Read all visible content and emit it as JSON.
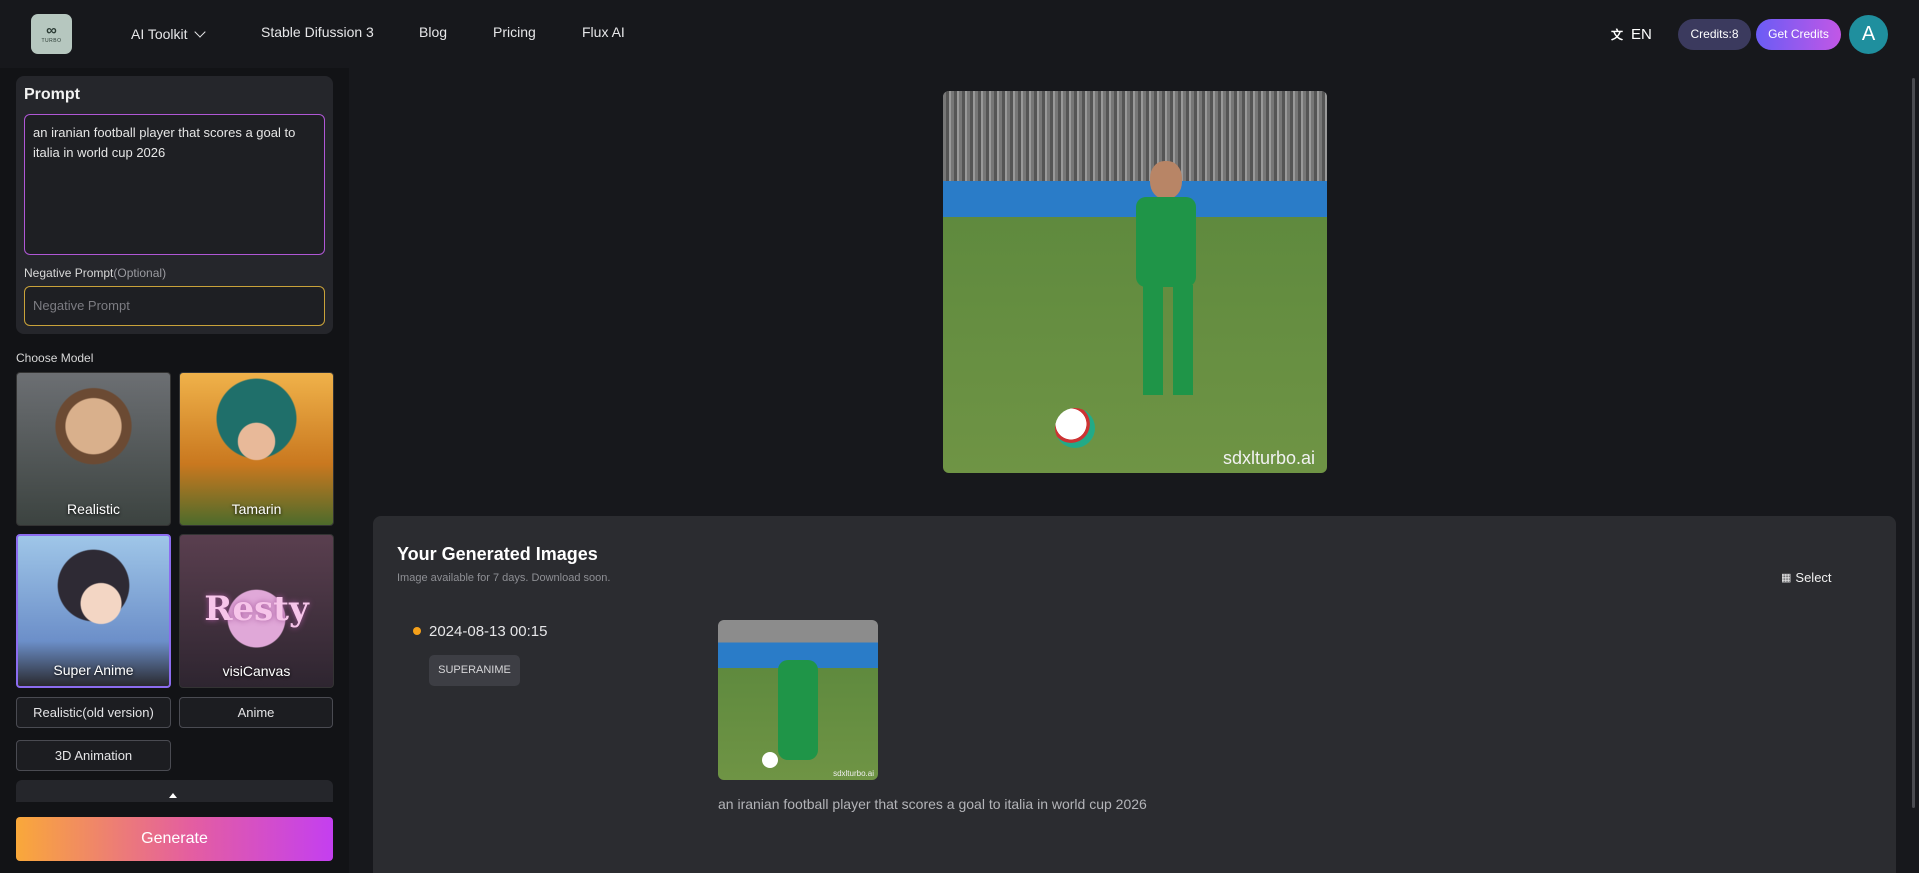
{
  "header": {
    "logo_text": "TURBO",
    "nav": [
      "AI Toolkit",
      "Stable Difussion 3",
      "Blog",
      "Pricing",
      "Flux AI"
    ],
    "language": "EN",
    "credits": "Credits:8",
    "get_credits": "Get Credits",
    "avatar_letter": "A"
  },
  "sidebar": {
    "prompt_title": "Prompt",
    "prompt_text": "an iranian football player that scores a goal to italia in world cup 2026",
    "negative_label": "Negative Prompt",
    "negative_optional": "(Optional)",
    "negative_placeholder": "Negative Prompt",
    "choose_model": "Choose Model",
    "models": [
      "Realistic",
      "Tamarin",
      "Super Anime",
      "visiCanvas"
    ],
    "selected_model": "Super Anime",
    "visi_art_word": "Resty",
    "chips": [
      "Realistic(old version)",
      "Anime",
      "3D Animation"
    ],
    "generate": "Generate"
  },
  "preview": {
    "watermark": "sdxlturbo.ai"
  },
  "generated": {
    "title": "Your Generated Images",
    "subtitle": "Image available for 7 days. Download soon.",
    "select": "Select",
    "date": "2024-08-13 00:15",
    "tag": "SUPERANIME",
    "thumb_watermark": "sdxlturbo.ai",
    "caption": "an iranian football player that scores a goal to italia in world cup 2026"
  },
  "colors": {
    "accent_purple": "#b057d6",
    "dot_orange": "#f5a11a"
  }
}
